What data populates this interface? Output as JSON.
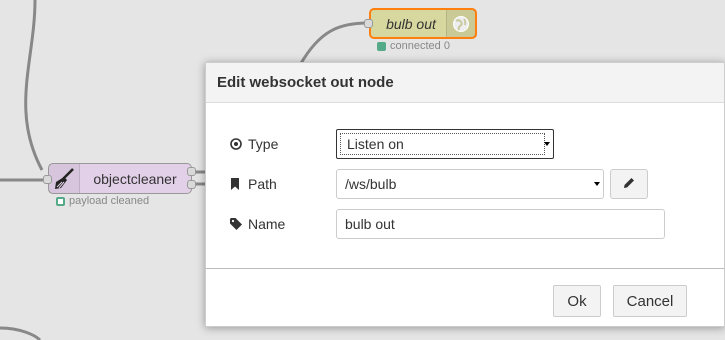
{
  "workspace": {
    "bulb_node": {
      "label": "bulb out",
      "status": "connected 0",
      "status_color": "#5a8"
    },
    "cleaner_node": {
      "label": "objectcleaner",
      "status": "payload cleaned",
      "status_color": "#5a8"
    }
  },
  "dialog": {
    "title": "Edit websocket out node",
    "fields": {
      "type": {
        "label": "Type",
        "value": "Listen on",
        "icon": "dot-circle-icon"
      },
      "path": {
        "label": "Path",
        "value": "/ws/bulb",
        "icon": "bookmark-icon"
      },
      "name": {
        "label": "Name",
        "value": "bulb out",
        "icon": "tag-icon"
      }
    },
    "buttons": {
      "ok": "Ok",
      "cancel": "Cancel"
    }
  },
  "colors": {
    "selection_border": "#ff7f0e",
    "bulb_node_fill": "#d7d7a0",
    "cleaner_node_fill": "#e2d0e8"
  }
}
